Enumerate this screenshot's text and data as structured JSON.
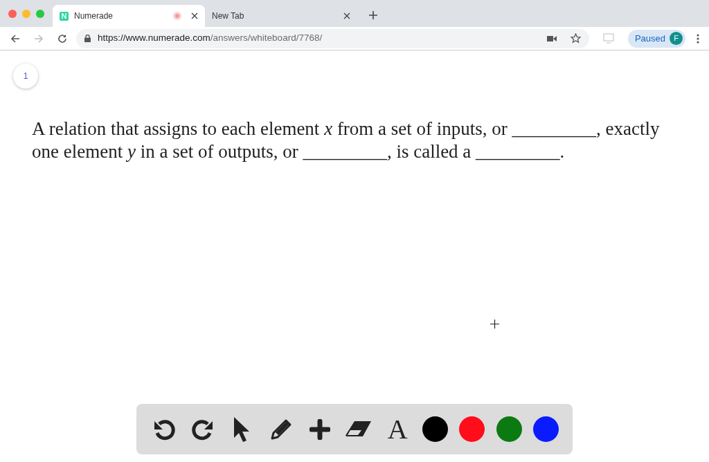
{
  "browser": {
    "tabs": [
      {
        "title": "Numerade",
        "selected": true,
        "recording": true
      },
      {
        "title": "New Tab",
        "selected": false,
        "recording": false
      }
    ],
    "url": {
      "host": "https://www.numerade.com",
      "path": "/answers/whiteboard/7768/"
    },
    "profile": {
      "status": "Paused",
      "initial": "F"
    }
  },
  "page": {
    "number": "1",
    "question": "A relation that assigns to each element *x* from a set of inputs, or _________, exactly one element *y* in a set of outputs, or _________, is called a _________."
  },
  "toolbar": {
    "tools": [
      {
        "kind": "undo"
      },
      {
        "kind": "redo"
      },
      {
        "kind": "pointer"
      },
      {
        "kind": "pencil"
      },
      {
        "kind": "plus"
      },
      {
        "kind": "eraser"
      },
      {
        "kind": "text",
        "label": "A"
      }
    ],
    "colors": [
      {
        "color": "#000000"
      },
      {
        "color": "#ff0d1a"
      },
      {
        "color": "#0b7a12"
      },
      {
        "color": "#0a1cff"
      }
    ]
  }
}
